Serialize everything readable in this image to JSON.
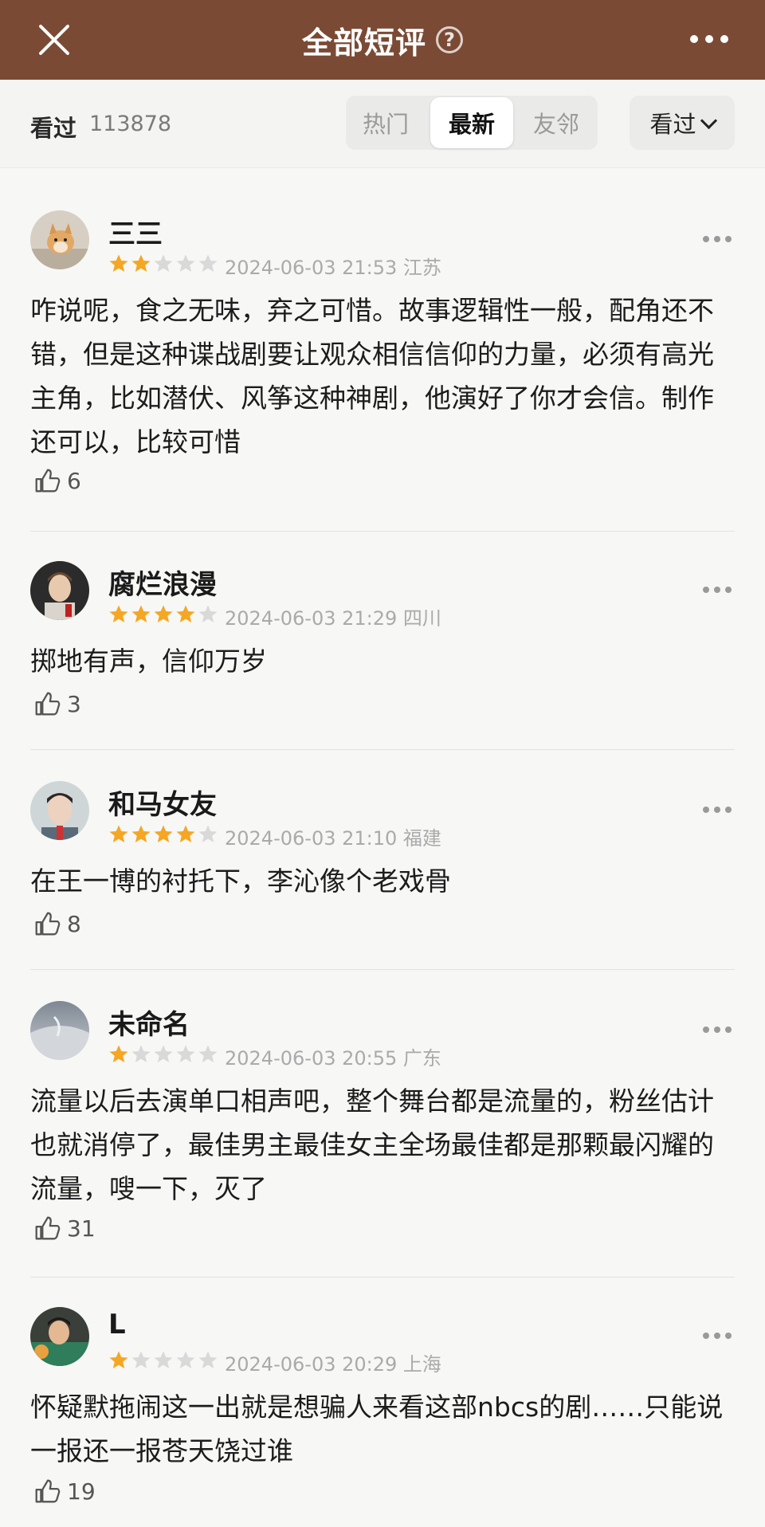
{
  "header": {
    "title": "全部短评",
    "help": "?"
  },
  "filter": {
    "watched_label": "看过",
    "watched_count": "113878",
    "tabs": [
      "热门",
      "最新",
      "友邻"
    ],
    "active_tab": "最新",
    "dropdown_label": "看过"
  },
  "colors": {
    "header_bg": "#7a4a34",
    "star_on": "#f5a623",
    "star_off": "#d9d9d9"
  },
  "reviews": [
    {
      "name": "三三",
      "rating": 2,
      "date": "2024-06-03 21:53",
      "location": "江苏",
      "text": "咋说呢，食之无味，弃之可惜。故事逻辑性一般，配角还不错，但是这种谍战剧要让观众相信信仰的力量，必须有高光主角，比如潜伏、风筝这种神剧，他演好了你才会信。制作还可以，比较可惜",
      "likes": "6"
    },
    {
      "name": "腐烂浪漫",
      "rating": 4,
      "date": "2024-06-03 21:29",
      "location": "四川",
      "text": "掷地有声，信仰万岁",
      "likes": "3"
    },
    {
      "name": "和马女友",
      "rating": 4,
      "date": "2024-06-03 21:10",
      "location": "福建",
      "text": "在王一博的衬托下，李沁像个老戏骨",
      "likes": "8"
    },
    {
      "name": "未命名",
      "rating": 1,
      "date": "2024-06-03 20:55",
      "location": "广东",
      "text": "流量以后去演单口相声吧，整个舞台都是流量的，粉丝估计也就消停了，最佳男主最佳女主全场最佳都是那颗最闪耀的流量，嗖一下，灭了",
      "likes": "31"
    },
    {
      "name": "L",
      "rating": 1,
      "date": "2024-06-03 20:29",
      "location": "上海",
      "text": "怀疑默拖闹这一出就是想骗人来看这部nbcs的剧……只能说一报还一报苍天饶过谁",
      "likes": "19"
    }
  ]
}
